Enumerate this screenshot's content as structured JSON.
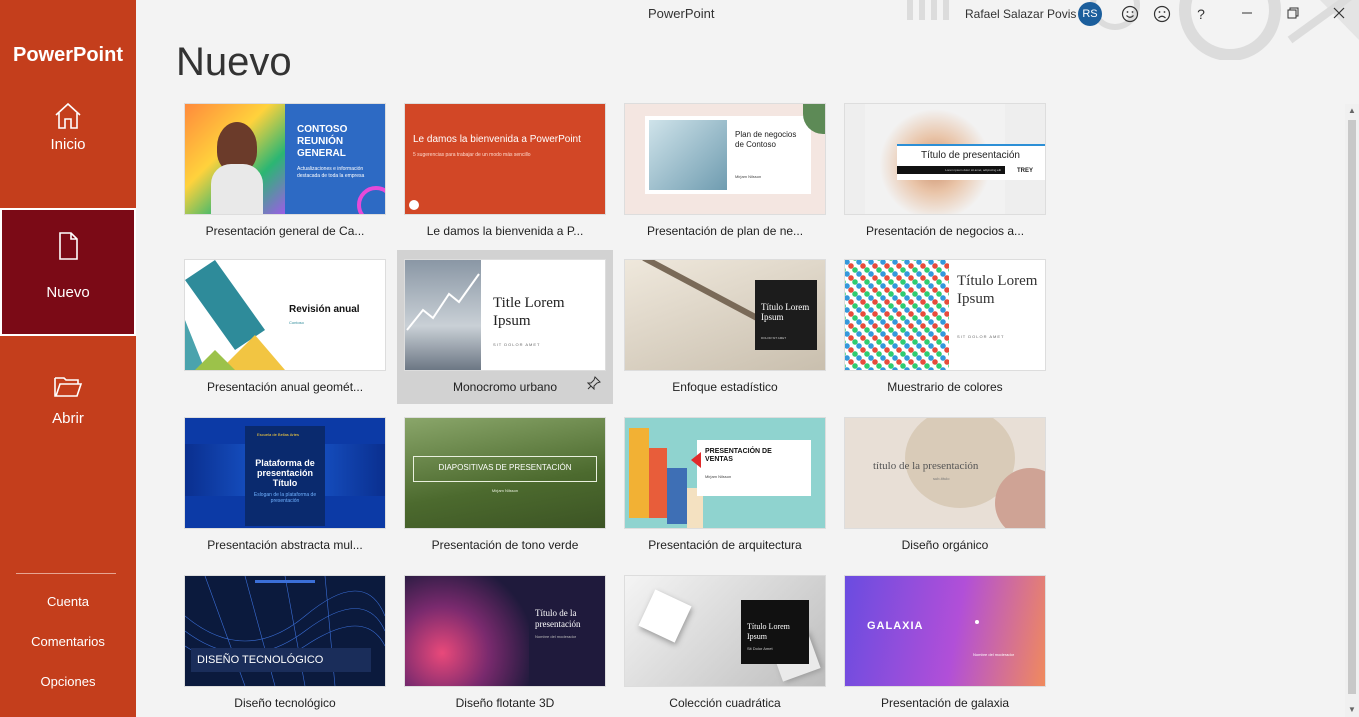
{
  "app": {
    "title": "PowerPoint",
    "brand": "PowerPoint"
  },
  "user": {
    "name": "Rafael Salazar Povis",
    "initials": "RS"
  },
  "window_controls": {
    "help": "?"
  },
  "nav": [
    {
      "label": "Inicio",
      "icon": "home-icon"
    },
    {
      "label": "Nuevo",
      "icon": "new-document-icon"
    },
    {
      "label": "Abrir",
      "icon": "folder-open-icon"
    }
  ],
  "footer_links": [
    "Cuenta",
    "Comentarios",
    "Opciones"
  ],
  "page": {
    "heading": "Nuevo"
  },
  "templates": [
    {
      "label": "Presentación general de Ca...",
      "thumb": {
        "title": "CONTOSO REUNIÓN GENERAL",
        "subtitle": "Actualizaciones e información destacada de toda la empresa"
      },
      "colors": {
        "bg": "#2d6ac4",
        "accent": "#f26b5b"
      }
    },
    {
      "label": "Le damos la bienvenida a P...",
      "thumb": {
        "title": "Le damos la bienvenida a PowerPoint",
        "subtitle": "5 sugerencias para trabajar de un modo más sencillo"
      },
      "colors": {
        "bg": "#d24726"
      }
    },
    {
      "label": "Presentación de plan de ne...",
      "thumb": {
        "title": "Plan de negocios de Contoso",
        "subtitle": "Mirjam Nilsson"
      },
      "colors": {
        "bg": "#f4e6e1"
      }
    },
    {
      "label": "Presentación de negocios a...",
      "thumb": {
        "title": "Título de presentación",
        "subtitle": "Lorem ipsum dolor sit amet, adipiscing elit",
        "brand": "TREY"
      },
      "colors": {
        "bg": "#eeeeee",
        "accent": "#2c8fd6"
      }
    },
    {
      "label": "Presentación anual geomét...",
      "thumb": {
        "title": "Revisión anual",
        "subtitle": "Contoso"
      },
      "colors": {
        "bg": "#ffffff",
        "accent": "#2e8b9a"
      }
    },
    {
      "label": "Monocromo urbano",
      "thumb": {
        "title": "Title Lorem Ipsum",
        "subtitle": "SIT DOLOR AMET"
      },
      "colors": {
        "bg": "#ffffff"
      }
    },
    {
      "label": "Enfoque estadístico",
      "thumb": {
        "title": "Título Lorem Ipsum",
        "subtitle": "DOLOR SIT AMET"
      },
      "colors": {
        "bg": "#d8d1c4"
      }
    },
    {
      "label": "Muestrario de colores",
      "thumb": {
        "title": "Título Lorem Ipsum",
        "subtitle": "SIT DOLOR AMET"
      },
      "colors": {
        "bg": "#ffffff"
      }
    },
    {
      "label": "Presentación abstracta mul...",
      "thumb": {
        "title": "Plataforma de presentación Título",
        "subtitle": "Eslogan de la plataforma de presentación",
        "brand": "Escuela de Bellas Artes"
      },
      "colors": {
        "bg": "#0c3aa6"
      }
    },
    {
      "label": "Presentación de tono verde",
      "thumb": {
        "title": "DIAPOSITIVAS DE PRESENTACIÓN",
        "subtitle": "Mirjam Nilsson"
      },
      "colors": {
        "bg": "#5a7a3a"
      }
    },
    {
      "label": "Presentación de arquitectura",
      "thumb": {
        "title": "PRESENTACIÓN DE VENTAS",
        "subtitle": "Mirjam Nilsson"
      },
      "colors": {
        "bg": "#8fd3cf",
        "accent": "#e02b2b"
      }
    },
    {
      "label": "Diseño orgánico",
      "thumb": {
        "title": "título de la presentación",
        "subtitle": "sub-título"
      },
      "colors": {
        "bg": "#e8dfd6"
      }
    },
    {
      "label": "Diseño tecnológico",
      "thumb": {
        "title": "DISEÑO TECNOLÓGICO",
        "subtitle": ""
      },
      "colors": {
        "bg": "#0b1a3d"
      }
    },
    {
      "label": "Diseño flotante 3D",
      "thumb": {
        "title": "Título de la presentación",
        "subtitle": "Nombre del moderador"
      },
      "colors": {
        "bg": "#1f1a3c",
        "accent": "#e9497a"
      }
    },
    {
      "label": "Colección cuadrática",
      "thumb": {
        "title": "Título Lorem Ipsum",
        "subtitle": "Sit Dolor Amet"
      },
      "colors": {
        "bg": "#e8e8e8"
      }
    },
    {
      "label": "Presentación de galaxia",
      "thumb": {
        "title": "GALAXIA",
        "subtitle": "Nombre del moderador"
      },
      "colors": {
        "bg": "#7a4ce0",
        "accent": "#f08a5d"
      }
    }
  ]
}
